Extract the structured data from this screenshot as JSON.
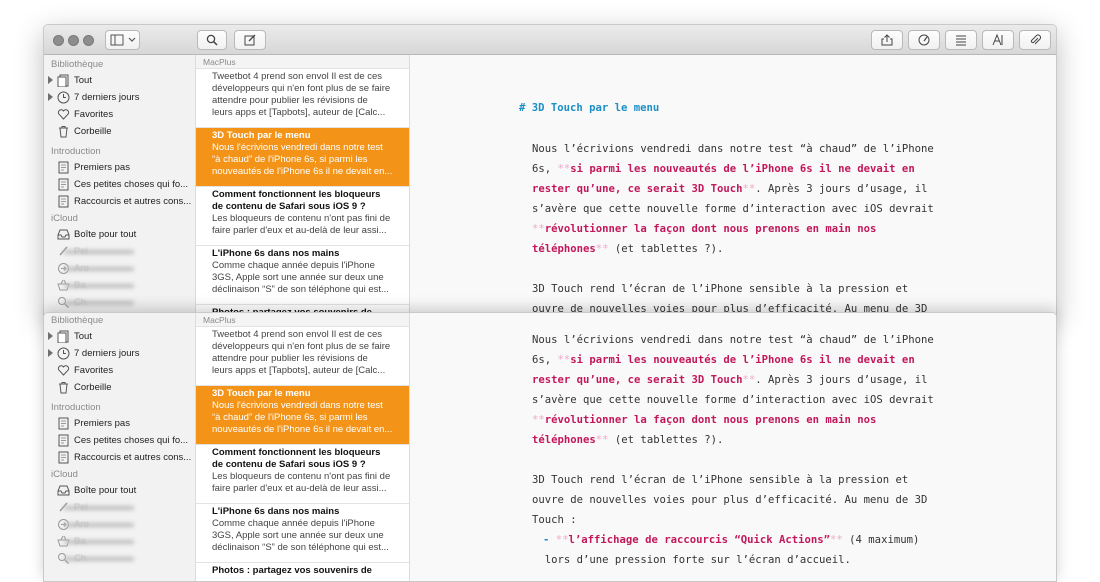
{
  "list_header": "MacPlus",
  "sidebar": {
    "sections": [
      {
        "title": "Bibliothèque",
        "items": [
          {
            "label": "Tout",
            "icon": "notes-stack-icon",
            "arrow": true
          },
          {
            "label": "7 derniers jours",
            "icon": "clock-icon",
            "arrow": true
          },
          {
            "label": "Favorites",
            "icon": "heart-icon",
            "arrow": false
          },
          {
            "label": "Corbeille",
            "icon": "trash-icon",
            "arrow": false
          }
        ]
      },
      {
        "title": "Introduction",
        "items": [
          {
            "label": "Premiers pas",
            "icon": "note-icon"
          },
          {
            "label": "Ces petites choses qui fo...",
            "icon": "note-icon"
          },
          {
            "label": "Raccourcis et autres cons...",
            "icon": "note-icon"
          }
        ]
      },
      {
        "title": "iCloud",
        "items": [
          {
            "label": "Boîte pour tout",
            "icon": "inbox-icon"
          },
          {
            "label": "Pei",
            "icon": "brush-icon",
            "blurred": true
          },
          {
            "label": "Aro",
            "icon": "circle-arrow-icon",
            "blurred": true
          },
          {
            "label": "Ba",
            "icon": "basket-icon",
            "blurred": true
          },
          {
            "label": "Ch",
            "icon": "magnifier-icon",
            "blurred": true
          }
        ]
      }
    ]
  },
  "notes": [
    {
      "title": "",
      "preview": [
        "Tweetbot 4 prend son envol Il est de ces",
        "développeurs qui n'en font plus de se faire",
        "attendre pour publier les révisions de",
        "leurs apps et [Tapbots], auteur de [Calc..."
      ]
    },
    {
      "title": "3D Touch par le menu",
      "preview": [
        "Nous l'écrivions vendredi dans notre test",
        "“à chaud” de l'iPhone 6s, si parmi les",
        "nouveautés de l'iPhone 6s il ne devait en..."
      ],
      "selected": true
    },
    {
      "title": "Comment fonctionnent les bloqueurs",
      "title2": "de contenu de Safari sous iOS 9 ?",
      "preview": [
        "Les bloqueurs de contenu n'ont pas fini de",
        "faire parler d'eux et au-delà de leur assi..."
      ]
    },
    {
      "title": "L'iPhone 6s dans nos mains",
      "preview": [
        "Comme chaque année depuis l'iPhone",
        "3GS, Apple sort une année sur deux une",
        "déclinaison “S” de son téléphone qui est..."
      ]
    },
    {
      "title": "Photos : partagez vos souvenirs de",
      "preview": []
    }
  ],
  "editor": {
    "heading_prefix": "# ",
    "heading": "3D Touch par le menu",
    "lines": [
      [
        [
          "t",
          "Nous l’écrivions vendredi dans notre test “à chaud” de l’iPhone"
        ]
      ],
      [
        [
          "t",
          "6s, "
        ],
        [
          "m",
          "**"
        ],
        [
          "b",
          "si parmi les nouveautés de l’iPhone 6s il ne devait en"
        ]
      ],
      [
        [
          "b",
          "rester qu’une, ce serait 3D Touch"
        ],
        [
          "m",
          "**"
        ],
        [
          "t",
          ". Après 3 jours d’usage, il"
        ]
      ],
      [
        [
          "t",
          "s’avère que cette nouvelle forme d’interaction avec iOS devrait"
        ]
      ],
      [
        [
          "m",
          "**"
        ],
        [
          "b",
          "révolutionner la façon dont nous prenons en main nos"
        ]
      ],
      [
        [
          "b",
          "téléphones"
        ],
        [
          "m",
          "**"
        ],
        [
          "t",
          " (et tablettes ?)."
        ]
      ],
      [
        [
          "t",
          ""
        ]
      ],
      [
        [
          "t",
          "3D Touch rend l’écran de l’iPhone sensible à la pression et"
        ]
      ],
      [
        [
          "t",
          "ouvre de nouvelles voies pour plus d’efficacité. Au menu de 3D"
        ]
      ],
      [
        [
          "t",
          "Touch :"
        ]
      ],
      [
        [
          "d",
          "- "
        ],
        [
          "m",
          "**"
        ],
        [
          "b",
          "l’affichage de raccourcis “Quick Actions”"
        ],
        [
          "m",
          "**"
        ],
        [
          "t",
          " (4 maximum)"
        ]
      ],
      [
        [
          "t",
          "  lors d’une pression forte sur l’écran d’accueil."
        ]
      ]
    ]
  }
}
